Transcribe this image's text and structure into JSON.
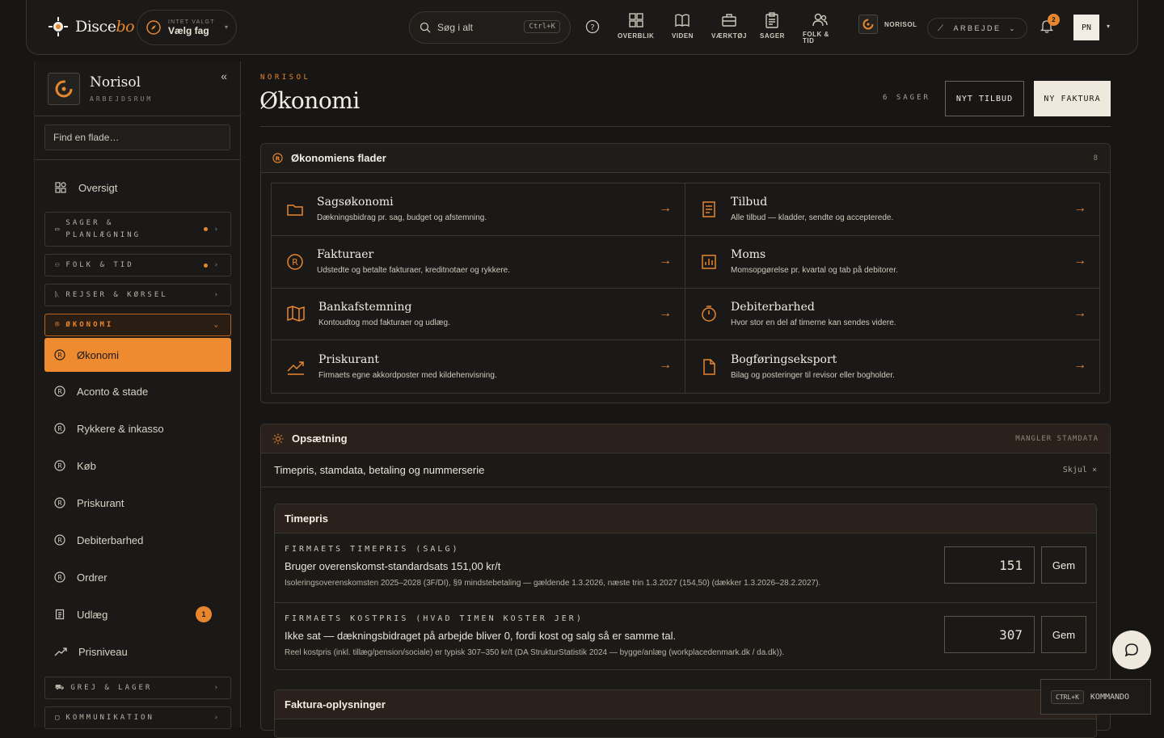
{
  "topbar": {
    "logo_main": "Disce",
    "logo_accent": "bo",
    "fag_line1": "INTET VALGT",
    "fag_line2": "Vælg fag",
    "search_placeholder": "Søg i alt",
    "search_shortcut": "Ctrl+K",
    "nav": [
      {
        "label": "OVERBLIK",
        "icon": "grid-icon"
      },
      {
        "label": "VIDEN",
        "icon": "book-icon"
      },
      {
        "label": "VÆRKTØJ",
        "icon": "toolbox-icon"
      },
      {
        "label": "SAGER",
        "icon": "clipboard-icon"
      },
      {
        "label": "FOLK &",
        "label2": "TID",
        "icon": "people-icon"
      }
    ],
    "workspace": "NORISOL",
    "mode": "ARBEJDE",
    "notifications": "2",
    "avatar": "PN"
  },
  "sidebar": {
    "title": "Norisol",
    "subtitle": "ARBEJDSRUM",
    "find_placeholder": "Find en flade…",
    "overview": "Oversigt",
    "groups": {
      "sager_line1": "SAGER &",
      "sager_line2": "PLANLÆGNING",
      "folk": "FOLK & TID",
      "rejser": "REJSER & KØRSEL",
      "okonomi": "ØKONOMI",
      "grej": "GREJ & LAGER",
      "kommunikation": "KOMMUNIKATION"
    },
    "items": [
      "Økonomi",
      "Aconto & stade",
      "Rykkere & inkasso",
      "Køb",
      "Priskurant",
      "Debiterbarhed",
      "Ordrer",
      "Udlæg",
      "Prisniveau"
    ],
    "udlaeg_count": "1"
  },
  "main": {
    "eyebrow": "NORISOL",
    "title": "Økonomi",
    "cases_count": "6 SAGER",
    "btn_offer": "NYT TILBUD",
    "btn_invoice": "NY FAKTURA"
  },
  "surfaces": {
    "title": "Økonomiens flader",
    "count": "8",
    "items": [
      {
        "title": "Sagsøkonomi",
        "desc": "Dækningsbidrag pr. sag, budget og afstemning.",
        "icon": "folder-icon"
      },
      {
        "title": "Tilbud",
        "desc": "Alle tilbud — kladder, sendte og accepterede.",
        "icon": "document-icon"
      },
      {
        "title": "Fakturaer",
        "desc": "Udstedte og betalte fakturaer, kreditnotaer og rykkere.",
        "icon": "currency-icon"
      },
      {
        "title": "Moms",
        "desc": "Momsopgørelse pr. kvartal og tab på debitorer.",
        "icon": "bar-chart-icon"
      },
      {
        "title": "Bankafstemning",
        "desc": "Kontoudtog mod fakturaer og udlæg.",
        "icon": "map-icon"
      },
      {
        "title": "Debiterbarhed",
        "desc": "Hvor stor en del af timerne kan sendes videre.",
        "icon": "stopwatch-icon"
      },
      {
        "title": "Priskurant",
        "desc": "Firmaets egne akkordposter med kildehenvisning.",
        "icon": "trend-icon"
      },
      {
        "title": "Bogføringseksport",
        "desc": "Bilag og posteringer til revisor eller bogholder.",
        "icon": "file-icon"
      }
    ]
  },
  "setup": {
    "title": "Opsætning",
    "status": "MANGLER STAMDATA",
    "subtitle": "Timepris, stamdata, betaling og nummerserie",
    "hide": "Skjul ×",
    "timepris": {
      "heading": "Timepris",
      "sale_label": "FIRMAETS TIMEPRIS (SALG)",
      "sale_main": "Bruger overenskomst-standardsats 151,00 kr/t",
      "sale_note": "Isoleringsoverenskomsten 2025–2028 (3F/DI), §9 mindstebetaling — gældende 1.3.2026, næste trin 1.3.2027 (154,50) (dækker 1.3.2026–28.2.2027).",
      "sale_value": "151",
      "cost_label": "FIRMAETS KOSTPRIS (HVAD TIMEN KOSTER JER)",
      "cost_main": "Ikke sat — dækningsbidraget på arbejde bliver 0, fordi kost og salg så er samme tal.",
      "cost_note": "Reel kostpris (inkl. tillæg/pension/sociale) er typisk 307–350 kr/t (DA StrukturStatistik 2024 — bygge/anlæg (workplacedenmark.dk / da.dk)).",
      "cost_value": "307",
      "save": "Gem"
    },
    "invoice_heading": "Faktura-oplysninger"
  },
  "footer": {
    "shortcut": "CTRL+K",
    "command": "KOMMANDO"
  },
  "colors": {
    "accent": "#e8862e",
    "bg": "#171614",
    "text": "#e9e3d8"
  }
}
